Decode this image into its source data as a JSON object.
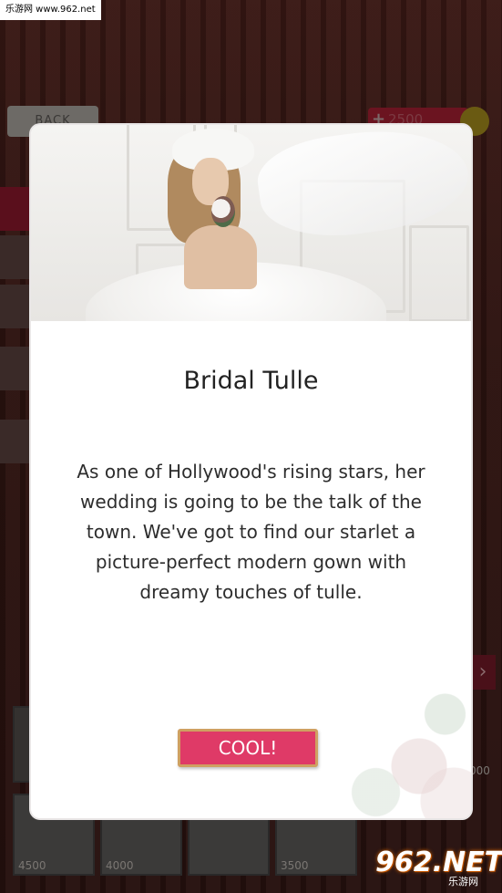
{
  "watermark_top": "乐游网 www.962.net",
  "header": {
    "back_label": "BACK",
    "currency_amount": "2500",
    "currency_plus": "+"
  },
  "shop": {
    "prices_bottom": [
      "4500",
      "4000",
      "3500"
    ],
    "price_corner": "000",
    "next_arrow": "›"
  },
  "modal": {
    "title": "Bridal Tulle",
    "description": "As one of Hollywood's rising stars, her wedding is going to be the talk of the town. We've got to find our starlet a picture-perfect modern gown with dreamy touches of tulle.",
    "button_label": "COOL!"
  },
  "watermark_br": {
    "main": "962.NET",
    "sub": "乐游网"
  },
  "colors": {
    "button": "#df3a67",
    "button_border": "#cfa061",
    "overlay_bg": "#2a1412"
  }
}
